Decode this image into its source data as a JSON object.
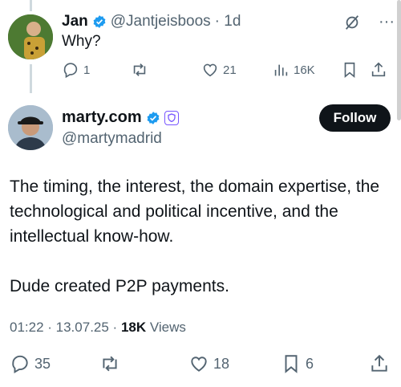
{
  "reply": {
    "name": "Jan",
    "handle": "@Jantjeisboos",
    "time": "· 1d",
    "text": "Why?",
    "stats": {
      "replies": "1",
      "retweets": "",
      "likes": "21",
      "views": "16K"
    }
  },
  "main": {
    "name": "marty.com",
    "handle": "@martymadrid",
    "follow_label": "Follow",
    "paragraph1": "The timing, the interest, the domain expertise, the technological and political  incentive, and the intellectual know-how.",
    "paragraph2": "Dude created P2P payments.",
    "timestamp": "01:22 · 13.07.25 ·",
    "views_count": "18K",
    "views_label": "Views",
    "stats": {
      "replies": "35",
      "retweets": "",
      "likes": "18",
      "bookmarks": "6"
    }
  },
  "colors": {
    "verified": "#1d9bf0",
    "brand": "#0f1419",
    "muted": "#536471",
    "affiliate": "#7856ff"
  },
  "icons": [
    "reply-icon",
    "retweet-icon",
    "like-icon",
    "views-icon",
    "bookmark-icon",
    "share-icon",
    "grok-icon",
    "more-icon",
    "verified-badge-icon",
    "affiliate-shield-icon"
  ]
}
